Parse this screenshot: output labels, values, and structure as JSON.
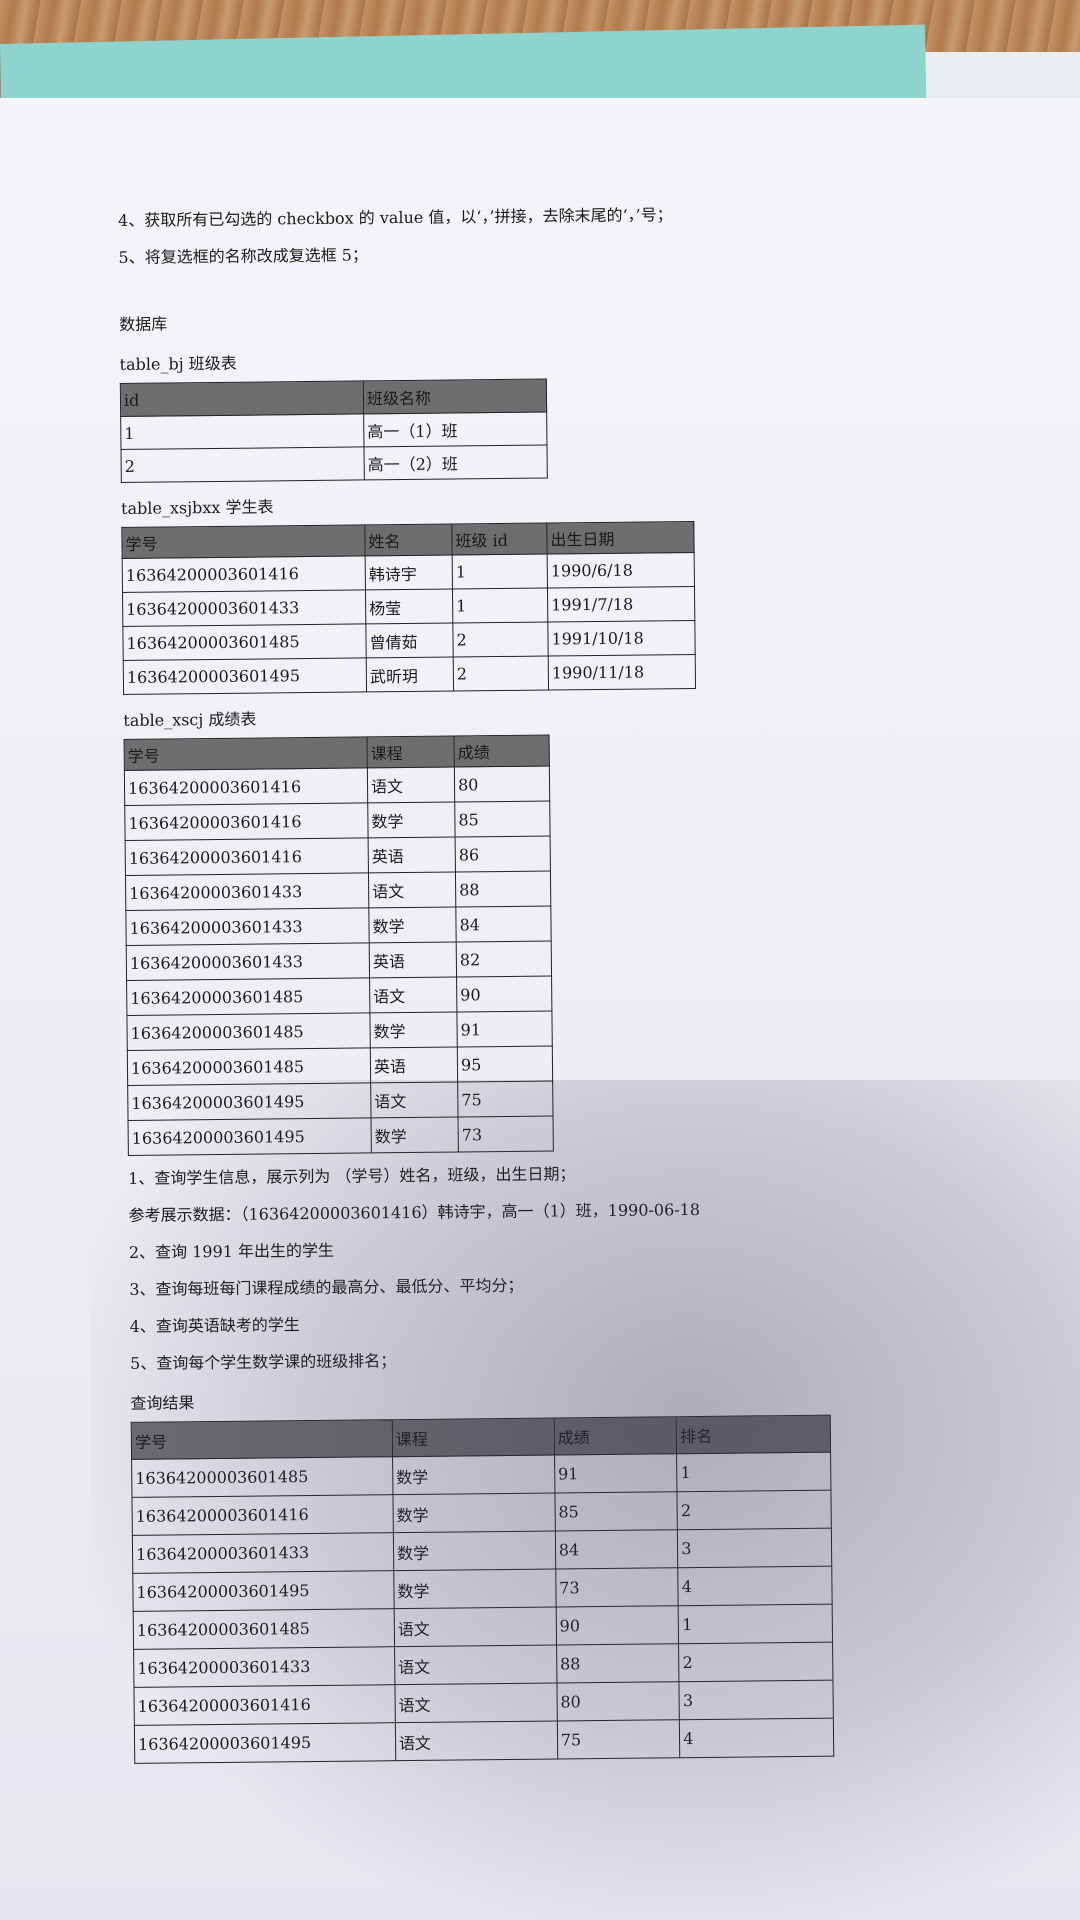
{
  "intro_lines": [
    "4、获取所有已勾选的 checkbox 的 value 值，以‘，’拼接，去除末尾的‘，’号；",
    "5、将复选框的名称改成复选框 5；"
  ],
  "db_title": "数据库",
  "table_bj": {
    "caption": "table_bj 班级表",
    "headers": [
      "id",
      "班级名称"
    ],
    "rows": [
      [
        "1",
        "高一（1）班"
      ],
      [
        "2",
        "高一（2）班"
      ]
    ]
  },
  "table_xsjbxx": {
    "caption": "table_xsjbxx 学生表",
    "headers": [
      "学号",
      "姓名",
      "班级 id",
      "出生日期"
    ],
    "rows": [
      [
        "16364200003601416",
        "韩诗宇",
        "1",
        "1990/6/18"
      ],
      [
        "16364200003601433",
        "杨莹",
        "1",
        "1991/7/18"
      ],
      [
        "16364200003601485",
        "曾倩茹",
        "2",
        "1991/10/18"
      ],
      [
        "16364200003601495",
        "武昕玥",
        "2",
        "1990/11/18"
      ]
    ]
  },
  "table_xscj": {
    "caption": "table_xscj 成绩表",
    "headers": [
      "学号",
      "课程",
      "成绩"
    ],
    "rows": [
      [
        "16364200003601416",
        "语文",
        "80"
      ],
      [
        "16364200003601416",
        "数学",
        "85"
      ],
      [
        "16364200003601416",
        "英语",
        "86"
      ],
      [
        "16364200003601433",
        "语文",
        "88"
      ],
      [
        "16364200003601433",
        "数学",
        "84"
      ],
      [
        "16364200003601433",
        "英语",
        "82"
      ],
      [
        "16364200003601485",
        "语文",
        "90"
      ],
      [
        "16364200003601485",
        "数学",
        "91"
      ],
      [
        "16364200003601485",
        "英语",
        "95"
      ],
      [
        "16364200003601495",
        "语文",
        "75"
      ],
      [
        "16364200003601495",
        "数学",
        "73"
      ]
    ]
  },
  "questions": [
    "1、查询学生信息，展示列为 （学号）姓名，班级，出生日期；",
    "参考展示数据：（16364200003601416）韩诗宇，高一（1）班，1990-06-18",
    "2、查询 1991 年出生的学生",
    "3、查询每班每门课程成绩的最高分、最低分、平均分；",
    "4、查询英语缺考的学生",
    "5、查询每个学生数学课的班级排名；"
  ],
  "result_title": "查询结果",
  "result_table": {
    "headers": [
      "学号",
      "课程",
      "成绩",
      "排名"
    ],
    "rows": [
      [
        "16364200003601485",
        "数学",
        "91",
        "1"
      ],
      [
        "16364200003601416",
        "数学",
        "85",
        "2"
      ],
      [
        "16364200003601433",
        "数学",
        "84",
        "3"
      ],
      [
        "16364200003601495",
        "数学",
        "73",
        "4"
      ],
      [
        "16364200003601485",
        "语文",
        "90",
        "1"
      ],
      [
        "16364200003601433",
        "语文",
        "88",
        "2"
      ],
      [
        "16364200003601416",
        "语文",
        "80",
        "3"
      ],
      [
        "16364200003601495",
        "语文",
        "75",
        "4"
      ]
    ]
  }
}
